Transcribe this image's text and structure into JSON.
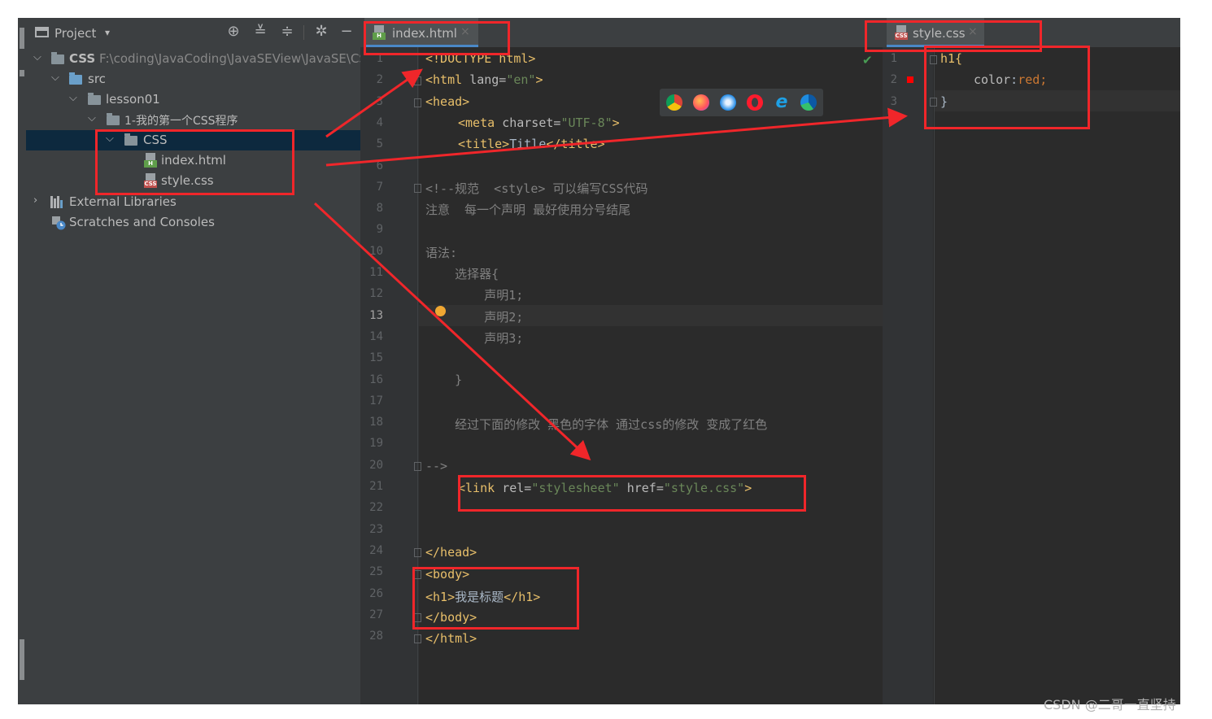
{
  "project_panel": {
    "title": "Project",
    "dropdown_glyph": "▾",
    "tools": [
      "locate-icon",
      "expand-all-icon",
      "collapse-all-icon",
      "settings-icon",
      "hide-icon"
    ],
    "tree": {
      "root_label": "CSS",
      "root_path": "F:\\coding\\JavaCoding\\JavaSEView\\JavaSE\\CSS",
      "src": "src",
      "lesson": "lesson01",
      "program": "1-我的第一个CSS程序",
      "css_folder": "CSS",
      "file_html": "index.html",
      "file_css": "style.css",
      "external": "External Libraries",
      "scratches": "Scratches and Consoles"
    }
  },
  "editor_left": {
    "tab_label": "index.html",
    "close_glyph": "×",
    "current_line": 13,
    "line_count": 28
  },
  "editor_right": {
    "tab_label": "style.css",
    "close_glyph": "×",
    "line_count": 3,
    "check_glyph": "✔"
  },
  "html_code": {
    "l1": "<!DOCTYPE html>",
    "l2_tag": "<html ",
    "l2_attr": "lang=",
    "l2_str": "\"en\"",
    "l2_end": ">",
    "l3": "<head>",
    "l4_tag": "<meta ",
    "l4_attr": "charset=",
    "l4_str": "\"UTF-8\"",
    "l4_end": ">",
    "l5_open": "<title>",
    "l5_text": "Title",
    "l5_close": "</title>",
    "l7": "<!--规范  <style> 可以编写CSS代码",
    "l8": "注意  每一个声明 最好使用分号结尾",
    "l10": "语法:",
    "l11": "    选择器{",
    "l12": "        声明1;",
    "l13": "        声明2;",
    "l14": "        声明3;",
    "l16": "    }",
    "l18": "    经过下面的修改 黑色的字体 通过css的修改 变成了红色",
    "l20": "-->",
    "l21_tag": "<link ",
    "l21_attr1": "rel=",
    "l21_str1": "\"stylesheet\"",
    "l21_attr2": " href=",
    "l21_str2": "\"style.css\"",
    "l21_end": ">",
    "l24": "</head>",
    "l25": "<body>",
    "l26_open": "<h1>",
    "l26_text": "我是标题",
    "l26_close": "</h1>",
    "l27": "</body>",
    "l28": "</html>"
  },
  "css_code": {
    "l1": "h1{",
    "l2_prop": "color",
    "l2_colon": ":",
    "l2_val": "red;",
    "l3": "}"
  },
  "browsers": [
    "chrome-icon",
    "firefox-icon",
    "safari-icon",
    "opera-icon",
    "ie-icon",
    "edge-icon"
  ],
  "colors": {
    "annotation": "#f0262a",
    "bg": "#2b2b2b",
    "panel": "#3c3f41",
    "tag": "#e8bf6a",
    "string": "#6a8759"
  },
  "watermark": "CSDN @二哥一直坚持"
}
